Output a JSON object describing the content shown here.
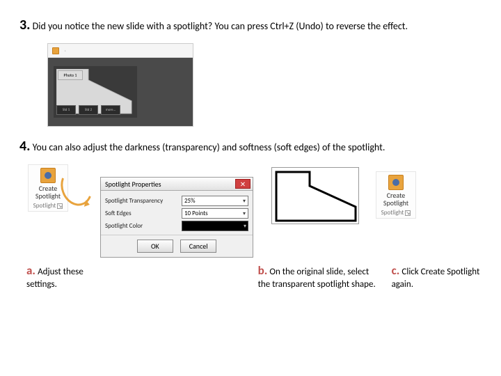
{
  "step3": {
    "num": "3",
    "dot": ".",
    "text": " Did you notice the new slide with a spotlight? You can press Ctrl+Z (Undo) to reverse the effect."
  },
  "fig1": {
    "hotbox": "Photo 1",
    "cells": [
      "Std 1",
      "Std 2",
      "more..."
    ]
  },
  "step4": {
    "num": "4",
    "dot": ".",
    "text": " You can also adjust the darkness (transparency) and softness (soft edges) of the spotlight."
  },
  "csbtn": {
    "line1": "Create",
    "line2": "Spotlight",
    "group": "Spotlight"
  },
  "dlg": {
    "title": "Spotlight Properties",
    "rows": {
      "transparency": {
        "label": "Spotlight Transparency",
        "value": "25%"
      },
      "soft": {
        "label": "Soft Edges",
        "value": "10 Points"
      },
      "color": {
        "label": "Spotlight Color"
      }
    },
    "ok": "OK",
    "cancel": "Cancel"
  },
  "subs": {
    "a": {
      "num": "a",
      "dot": ".",
      "text": " Adjust these settings."
    },
    "b": {
      "num": "b",
      "dot": ".",
      "text": " On the original slide, select the transparent spotlight shape."
    },
    "c": {
      "num": "c",
      "dot": ".",
      "text": " Click Create Spotlight again."
    }
  }
}
